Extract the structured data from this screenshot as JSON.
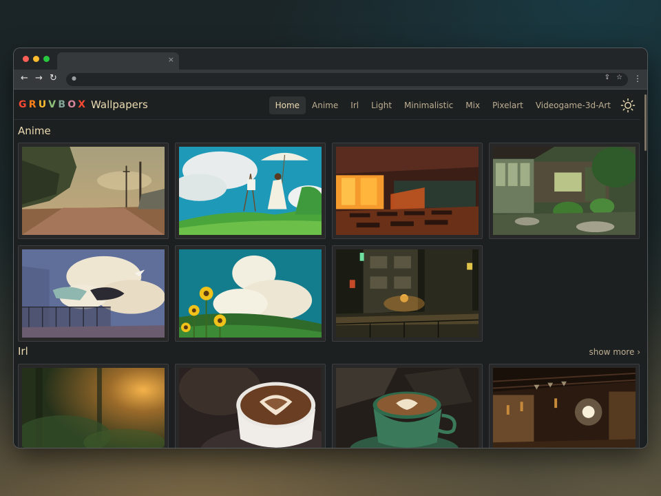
{
  "browser": {
    "close_tab_glyph": "×",
    "back_glyph": "←",
    "forward_glyph": "→",
    "reload_glyph": "↻",
    "menu_glyph": "⋮",
    "traffic_light_colors": [
      "#ff5f57",
      "#febc2e",
      "#28c840"
    ]
  },
  "site": {
    "logo_letters": [
      {
        "char": "G",
        "color": "#fb4934"
      },
      {
        "char": "R",
        "color": "#fe8019"
      },
      {
        "char": "U",
        "color": "#fabd2f"
      },
      {
        "char": "V",
        "color": "#8ec07c"
      },
      {
        "char": "B",
        "color": "#83a598"
      },
      {
        "char": "O",
        "color": "#d3869b"
      },
      {
        "char": "X",
        "color": "#fb4934"
      }
    ],
    "title": "Wallpapers",
    "theme_toggle_icon": "sun-icon"
  },
  "nav": {
    "items": [
      "Home",
      "Anime",
      "Irl",
      "Light",
      "Minimalistic",
      "Mix",
      "Pixelart",
      "Videogame-3d-Art"
    ],
    "active": "Home"
  },
  "sections": {
    "anime": {
      "title": "Anime",
      "wallpapers": [
        "country-road",
        "girl-with-parasol",
        "sunset-classroom",
        "japanese-garden-house",
        "balcony-clouds",
        "sunflowers-clouds",
        "night-alley"
      ]
    },
    "irl": {
      "title": "Irl",
      "show_more": "show more",
      "wallpapers": [
        "forest-sunlight",
        "latte-art-cup",
        "green-coffee-cup",
        "lantern-cabin"
      ]
    }
  },
  "colors": {
    "background": "#1d2021",
    "text": "#ebdbb2",
    "muted": "#bdae93"
  }
}
